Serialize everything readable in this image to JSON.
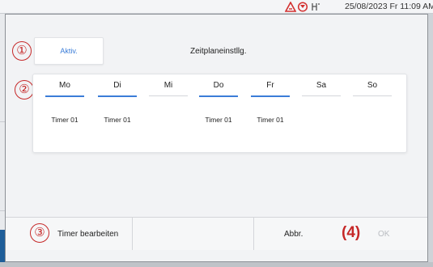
{
  "status": {
    "datetime": "25/08/2023 Fr 11:09 AM",
    "icons": [
      "warning-triangle-icon",
      "filter-icon",
      "water-icon"
    ]
  },
  "markers": [
    "①",
    "②",
    "③"
  ],
  "dialog": {
    "active_button": "Aktiv.",
    "title": "Zeitplaneinstllg.",
    "days": [
      {
        "label": "Mo",
        "active": true,
        "timer": "Timer 01"
      },
      {
        "label": "Di",
        "active": true,
        "timer": "Timer 01"
      },
      {
        "label": "Mi",
        "active": false,
        "timer": ""
      },
      {
        "label": "Do",
        "active": true,
        "timer": "Timer 01"
      },
      {
        "label": "Fr",
        "active": true,
        "timer": "Timer 01"
      },
      {
        "label": "Sa",
        "active": false,
        "timer": ""
      },
      {
        "label": "So",
        "active": false,
        "timer": ""
      }
    ],
    "bottom": {
      "edit_timer": "Timer bearbeiten",
      "cancel": "Abbr.",
      "ok": "OK",
      "annotation_4": "(4)"
    }
  },
  "colors": {
    "accent": "#3b7dd8",
    "annotation": "#c62828"
  }
}
